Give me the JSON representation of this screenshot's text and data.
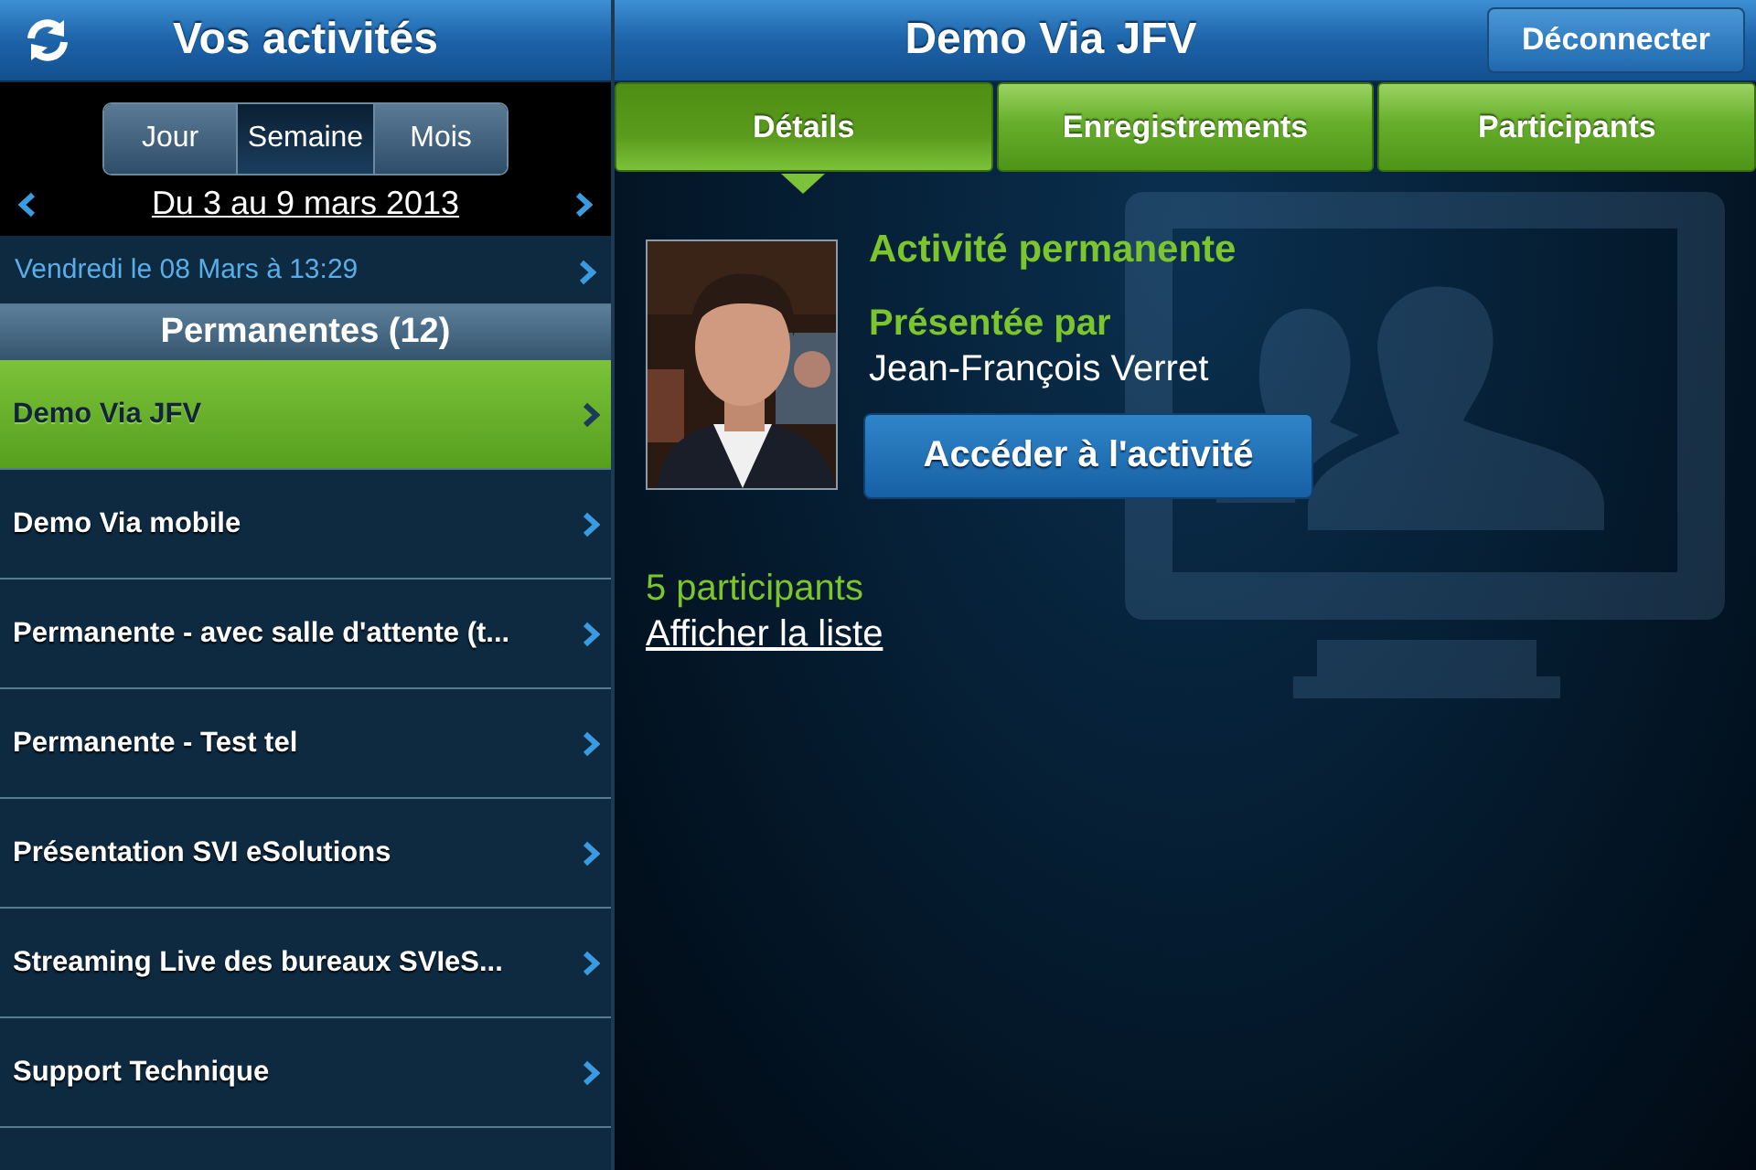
{
  "sidebar": {
    "title": "Vos activités",
    "segments": [
      {
        "label": "Jour",
        "selected": false
      },
      {
        "label": "Semaine",
        "selected": true
      },
      {
        "label": "Mois",
        "selected": false
      }
    ],
    "date_range": "Du 3 au 9 mars 2013",
    "partial_item": {
      "subtitle": "Vendredi le 08 Mars à 13:29"
    },
    "section": "Permanentes (12)",
    "items": [
      {
        "label": "Demo Via JFV",
        "selected": true
      },
      {
        "label": "Demo Via mobile",
        "selected": false
      },
      {
        "label": "Permanente - avec salle d'attente (t...",
        "selected": false
      },
      {
        "label": "Permanente - Test tel",
        "selected": false
      },
      {
        "label": "Présentation SVI eSolutions",
        "selected": false
      },
      {
        "label": "Streaming Live des bureaux SVIeS...",
        "selected": false
      },
      {
        "label": "Support Technique",
        "selected": false
      }
    ]
  },
  "detail": {
    "title": "Demo Via JFV",
    "logout_button": "Déconnecter",
    "tabs": [
      {
        "label": "Détails",
        "selected": true
      },
      {
        "label": "Enregistrements",
        "selected": false
      },
      {
        "label": "Participants",
        "selected": false
      }
    ],
    "heading": "Activité permanente",
    "presenter_label": "Présentée par",
    "presenter": "Jean-François Verret",
    "access_button": "Accéder à l'activité",
    "participants": "5 participants",
    "list_link": "Afficher la liste"
  }
}
